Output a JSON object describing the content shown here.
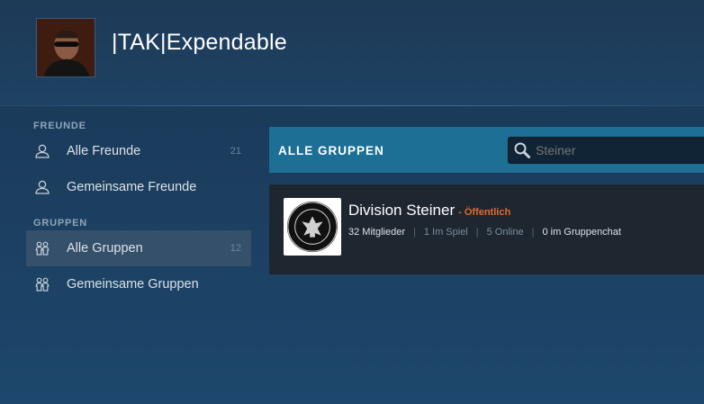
{
  "profile": {
    "username": "|TAK|Expendable"
  },
  "sidebar": {
    "friends_section": "FREUNDE",
    "groups_section": "GRUPPEN",
    "items": [
      {
        "label": "Alle Freunde",
        "count": "21",
        "icon": "user-icon"
      },
      {
        "label": "Gemeinsame Freunde",
        "count": "",
        "icon": "user-icon"
      },
      {
        "label": "Alle Gruppen",
        "count": "12",
        "icon": "group-icon",
        "active": true
      },
      {
        "label": "Gemeinsame Gruppen",
        "count": "",
        "icon": "group-icon"
      }
    ]
  },
  "main": {
    "title": "ALLE GRUPPEN",
    "search": {
      "value": "",
      "placeholder": "Steiner",
      "icon": "search-icon"
    },
    "groups": [
      {
        "name": "Division Steiner",
        "visibility": "- Öffentlich",
        "members": "32 Mitglieder",
        "in_game": "1 Im Spiel",
        "online": "5 Online",
        "chat": "0 im Gruppenchat",
        "emblem_text": "GOTT MIT UNS"
      }
    ],
    "separator": "|"
  },
  "colors": {
    "accent_header": "#1d6f96",
    "active_item": "#35506b",
    "public_badge": "#e06a2e",
    "card_bg": "#1e2630"
  }
}
